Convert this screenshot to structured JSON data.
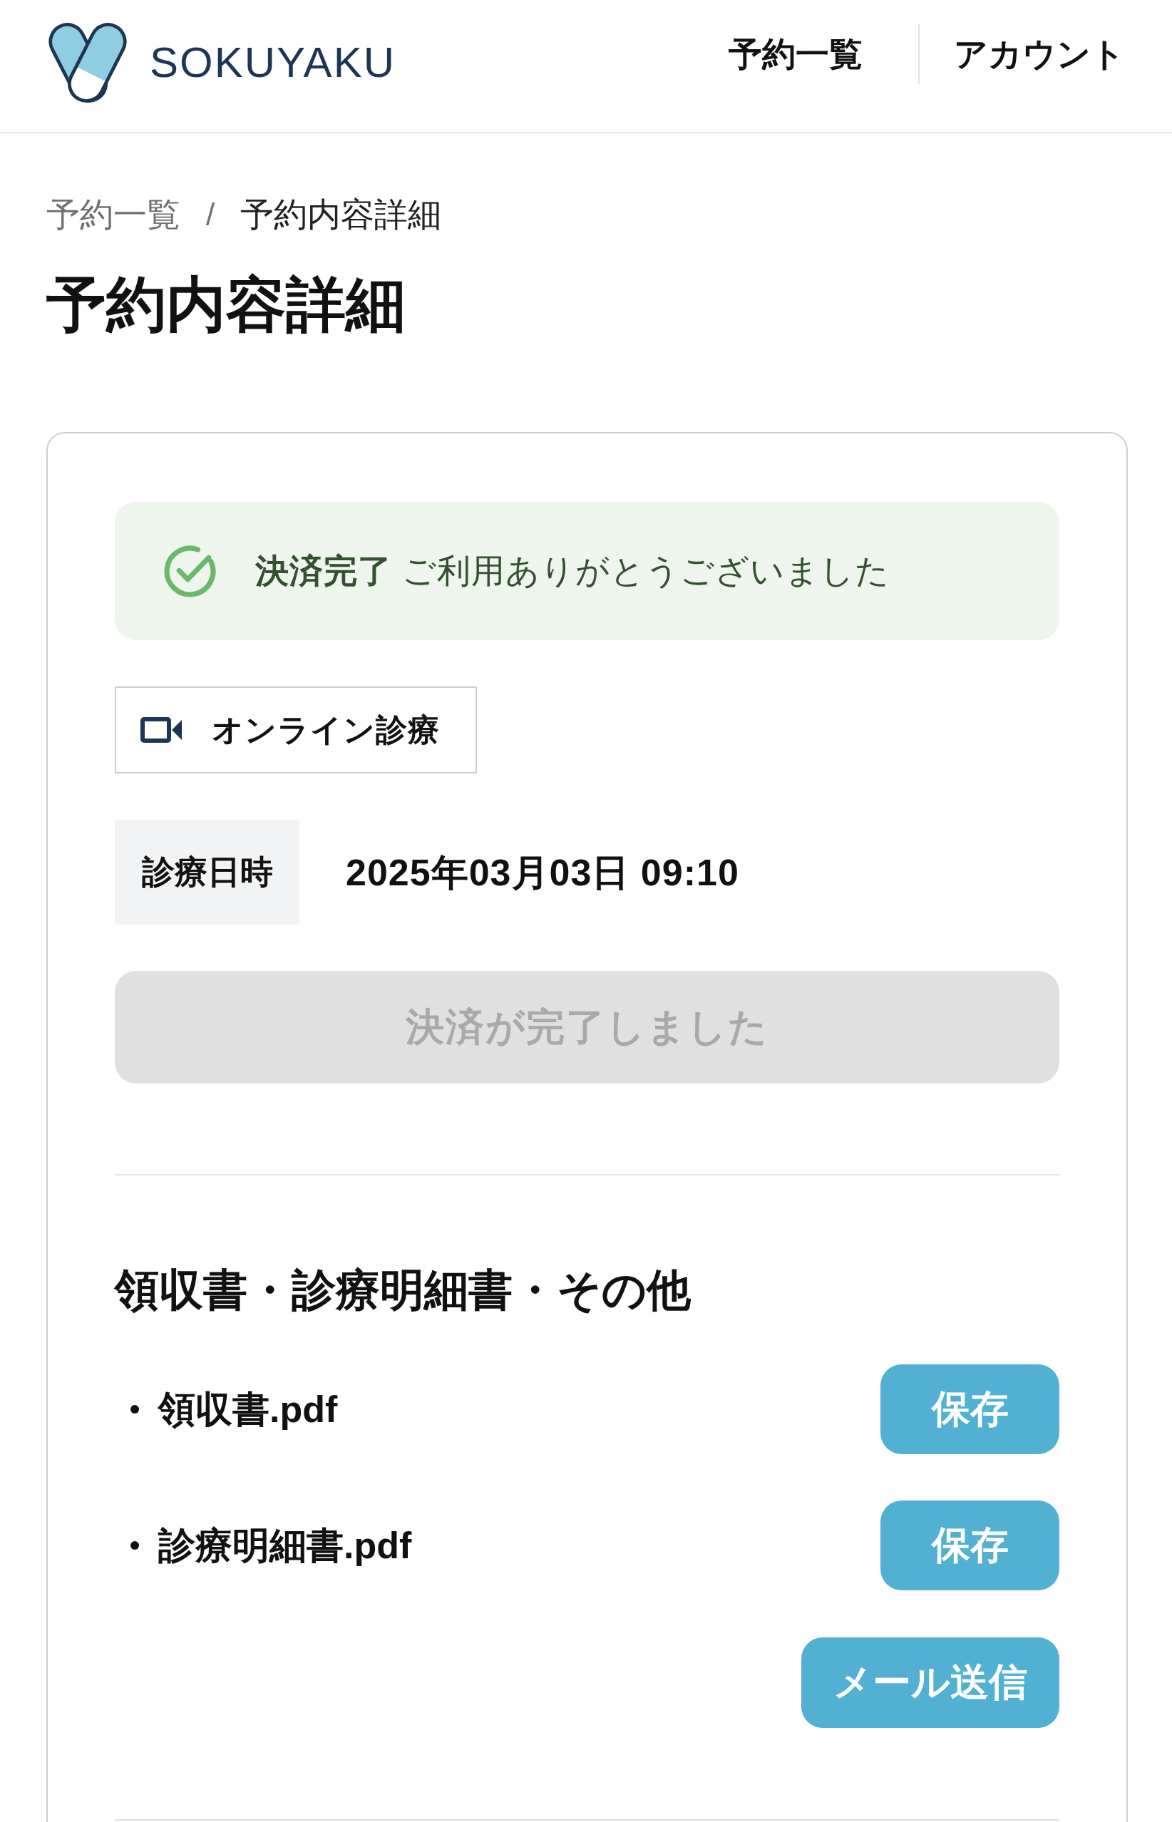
{
  "header": {
    "brand": "SOKUYAKU",
    "nav": [
      {
        "label": "予約一覧"
      },
      {
        "label": "アカウント"
      }
    ]
  },
  "breadcrumb": {
    "items": [
      {
        "label": "予約一覧",
        "current": false
      },
      {
        "label": "予約内容詳細",
        "current": true
      }
    ],
    "separator": "/"
  },
  "title": "予約内容詳細",
  "alert": {
    "kind": "success",
    "message": "**決済完了** ご利用ありがとうございました"
  },
  "consultation": {
    "label": "オンライン診療"
  },
  "schedule": {
    "label": "診療日時",
    "value": "2025年03月03日 09:10"
  },
  "payment_button": {
    "label": "決済が完了しました",
    "disabled": true
  },
  "documents": {
    "heading": "領収書・診療明細書・その他",
    "files": [
      {
        "name": "領収書.pdf",
        "action": "保存"
      },
      {
        "name": "診療明細書.pdf",
        "action": "保存"
      }
    ],
    "send_button": "メール送信"
  }
}
